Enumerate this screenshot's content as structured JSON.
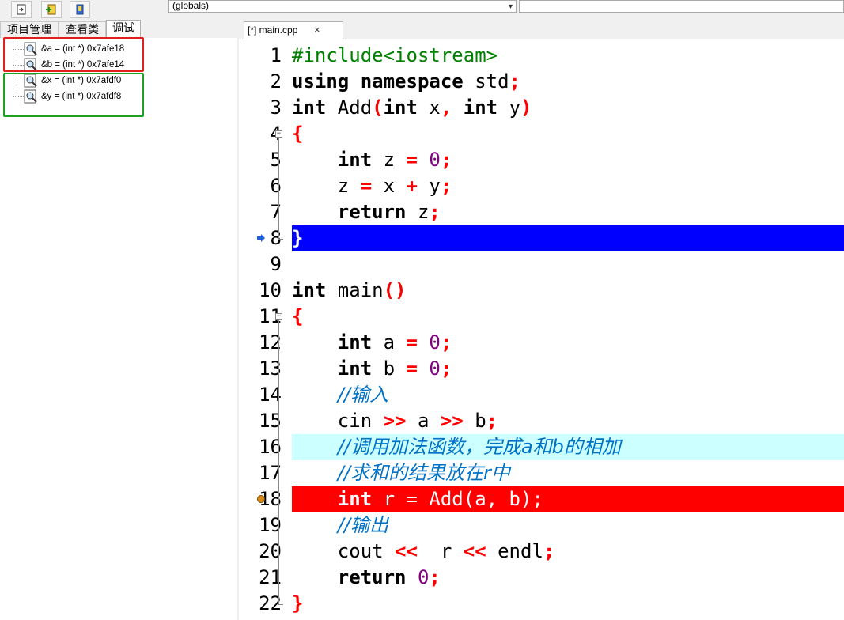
{
  "toolbar": {
    "buttons": [
      "step-into-icon",
      "add-watch-icon",
      "bookmark-icon"
    ],
    "scope_combo": "(globals)"
  },
  "left_tabs": [
    "项目管理",
    "查看类",
    "调试"
  ],
  "watches": [
    {
      "label": "&a = (int *) 0x7afe18"
    },
    {
      "label": "&b = (int *) 0x7afe14"
    },
    {
      "label": "&x = (int *) 0x7afdf0"
    },
    {
      "label": "&y = (int *) 0x7afdf8"
    }
  ],
  "highlight_colors": {
    "red_box": "#e02020",
    "green_box": "#20a020"
  },
  "editor": {
    "tab_title": "[*] main.cpp",
    "tab_close": "×",
    "lines": [
      {
        "n": "1",
        "tokens": [
          [
            "pre",
            "#include<iostream>"
          ]
        ]
      },
      {
        "n": "2",
        "tokens": [
          [
            "kw",
            "using"
          ],
          [
            "t",
            " "
          ],
          [
            "kw",
            "namespace"
          ],
          [
            "t",
            " std"
          ],
          [
            "op",
            ";"
          ]
        ]
      },
      {
        "n": "3",
        "tokens": [
          [
            "kw",
            "int"
          ],
          [
            "t",
            " Add"
          ],
          [
            "op",
            "("
          ],
          [
            "kw",
            "int"
          ],
          [
            "t",
            " x"
          ],
          [
            "op",
            ","
          ],
          [
            "t",
            " "
          ],
          [
            "kw",
            "int"
          ],
          [
            "t",
            " y"
          ],
          [
            "op",
            ")"
          ]
        ]
      },
      {
        "n": "4",
        "tokens": [
          [
            "op",
            "{"
          ]
        ]
      },
      {
        "n": "5",
        "tokens": [
          [
            "t",
            "    "
          ],
          [
            "kw",
            "int"
          ],
          [
            "t",
            " z "
          ],
          [
            "op",
            "="
          ],
          [
            "t",
            " "
          ],
          [
            "num",
            "0"
          ],
          [
            "op",
            ";"
          ]
        ]
      },
      {
        "n": "6",
        "tokens": [
          [
            "t",
            "    z "
          ],
          [
            "op",
            "="
          ],
          [
            "t",
            " x "
          ],
          [
            "op",
            "+"
          ],
          [
            "t",
            " y"
          ],
          [
            "op",
            ";"
          ]
        ]
      },
      {
        "n": "7",
        "tokens": [
          [
            "t",
            "    "
          ],
          [
            "kw",
            "return"
          ],
          [
            "t",
            " z"
          ],
          [
            "op",
            ";"
          ]
        ]
      },
      {
        "n": "8",
        "tokens": [
          [
            "op",
            "}"
          ]
        ]
      },
      {
        "n": "9",
        "tokens": []
      },
      {
        "n": "10",
        "tokens": [
          [
            "kw",
            "int"
          ],
          [
            "t",
            " main"
          ],
          [
            "op",
            "()"
          ]
        ]
      },
      {
        "n": "11",
        "tokens": [
          [
            "op",
            "{"
          ]
        ]
      },
      {
        "n": "12",
        "tokens": [
          [
            "t",
            "    "
          ],
          [
            "kw",
            "int"
          ],
          [
            "t",
            " a "
          ],
          [
            "op",
            "="
          ],
          [
            "t",
            " "
          ],
          [
            "num",
            "0"
          ],
          [
            "op",
            ";"
          ]
        ]
      },
      {
        "n": "13",
        "tokens": [
          [
            "t",
            "    "
          ],
          [
            "kw",
            "int"
          ],
          [
            "t",
            " b "
          ],
          [
            "op",
            "="
          ],
          [
            "t",
            " "
          ],
          [
            "num",
            "0"
          ],
          [
            "op",
            ";"
          ]
        ]
      },
      {
        "n": "14",
        "tokens": [
          [
            "t",
            "    "
          ],
          [
            "cm",
            "//输入"
          ]
        ]
      },
      {
        "n": "15",
        "tokens": [
          [
            "t",
            "    cin "
          ],
          [
            "op",
            ">>"
          ],
          [
            "t",
            " a "
          ],
          [
            "op",
            ">>"
          ],
          [
            "t",
            " b"
          ],
          [
            "op",
            ";"
          ]
        ]
      },
      {
        "n": "16",
        "tokens": [
          [
            "t",
            "    "
          ],
          [
            "cm",
            "//调用加法函数，完成a和b的相加"
          ]
        ]
      },
      {
        "n": "17",
        "tokens": [
          [
            "t",
            "    "
          ],
          [
            "cm",
            "//求和的结果放在r中"
          ]
        ]
      },
      {
        "n": "18",
        "tokens": [
          [
            "t",
            "    "
          ],
          [
            "kw",
            "int"
          ],
          [
            "t",
            " r = Add(a, b);"
          ]
        ]
      },
      {
        "n": "19",
        "tokens": [
          [
            "t",
            "    "
          ],
          [
            "cm",
            "//输出"
          ]
        ]
      },
      {
        "n": "20",
        "tokens": [
          [
            "t",
            "    cout "
          ],
          [
            "op",
            "<<"
          ],
          [
            "t",
            "  r "
          ],
          [
            "op",
            "<<"
          ],
          [
            "t",
            " endl"
          ],
          [
            "op",
            ";"
          ]
        ]
      },
      {
        "n": "21",
        "tokens": [
          [
            "t",
            "    "
          ],
          [
            "kw",
            "return"
          ],
          [
            "t",
            " "
          ],
          [
            "num",
            "0"
          ],
          [
            "op",
            ";"
          ]
        ]
      },
      {
        "n": "22",
        "tokens": [
          [
            "op",
            "}"
          ]
        ]
      }
    ],
    "line_highlights": {
      "8": "blue",
      "16": "cyan",
      "18": "red"
    },
    "current_line_color": "#0000ff",
    "watch_line_color": "#ccffff",
    "breakpoint_color": "#ff0000"
  }
}
